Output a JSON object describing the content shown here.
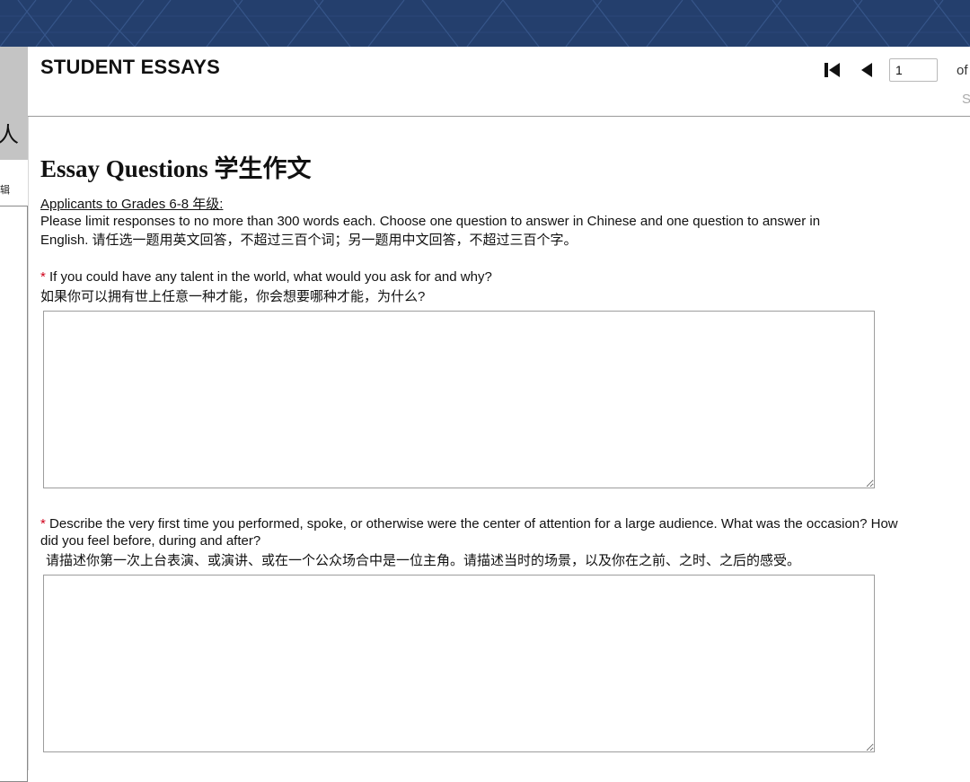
{
  "sidebar": {
    "glyph": "人",
    "mini_label": "辑"
  },
  "header": {
    "title": "STUDENT ESSAYS",
    "page_input_value": "1",
    "page_of_label": "of",
    "page_sub_label": "S"
  },
  "icons": {
    "first_page": "first-page-icon",
    "previous_page": "previous-page-icon"
  },
  "section": {
    "title": "Essay Questions 学生作文",
    "applicants_label": "Applicants to Grades 6-8 年级:",
    "instructions": "Please limit responses to no more than 300 words each. Choose one question to answer in Chinese and one question to answer in English. 请任选一题用英文回答，不超过三百个词；另一题用中文回答，不超过三百个字。"
  },
  "questions": [
    {
      "required_marker": "*",
      "text_en": "If you could have any talent in the world, what would you ask for and why?",
      "text_cn": "如果你可以拥有世上任意一种才能，你会想要哪种才能，为什么?",
      "answer": ""
    },
    {
      "required_marker": "*",
      "text_en": "Describe the very first time you performed, spoke, or otherwise were the center of attention for a large audience. What was the occasion? How did you feel before, during and after?",
      "text_cn": "请描述你第一次上台表演、或演讲、或在一个公众场合中是一位主角。请描述当时的场景，以及你在之前、之时、之后的感受。",
      "answer": ""
    }
  ],
  "colors": {
    "banner": "#243f6d",
    "required": "#d0021b",
    "sidebar": "#c4c4c4"
  }
}
